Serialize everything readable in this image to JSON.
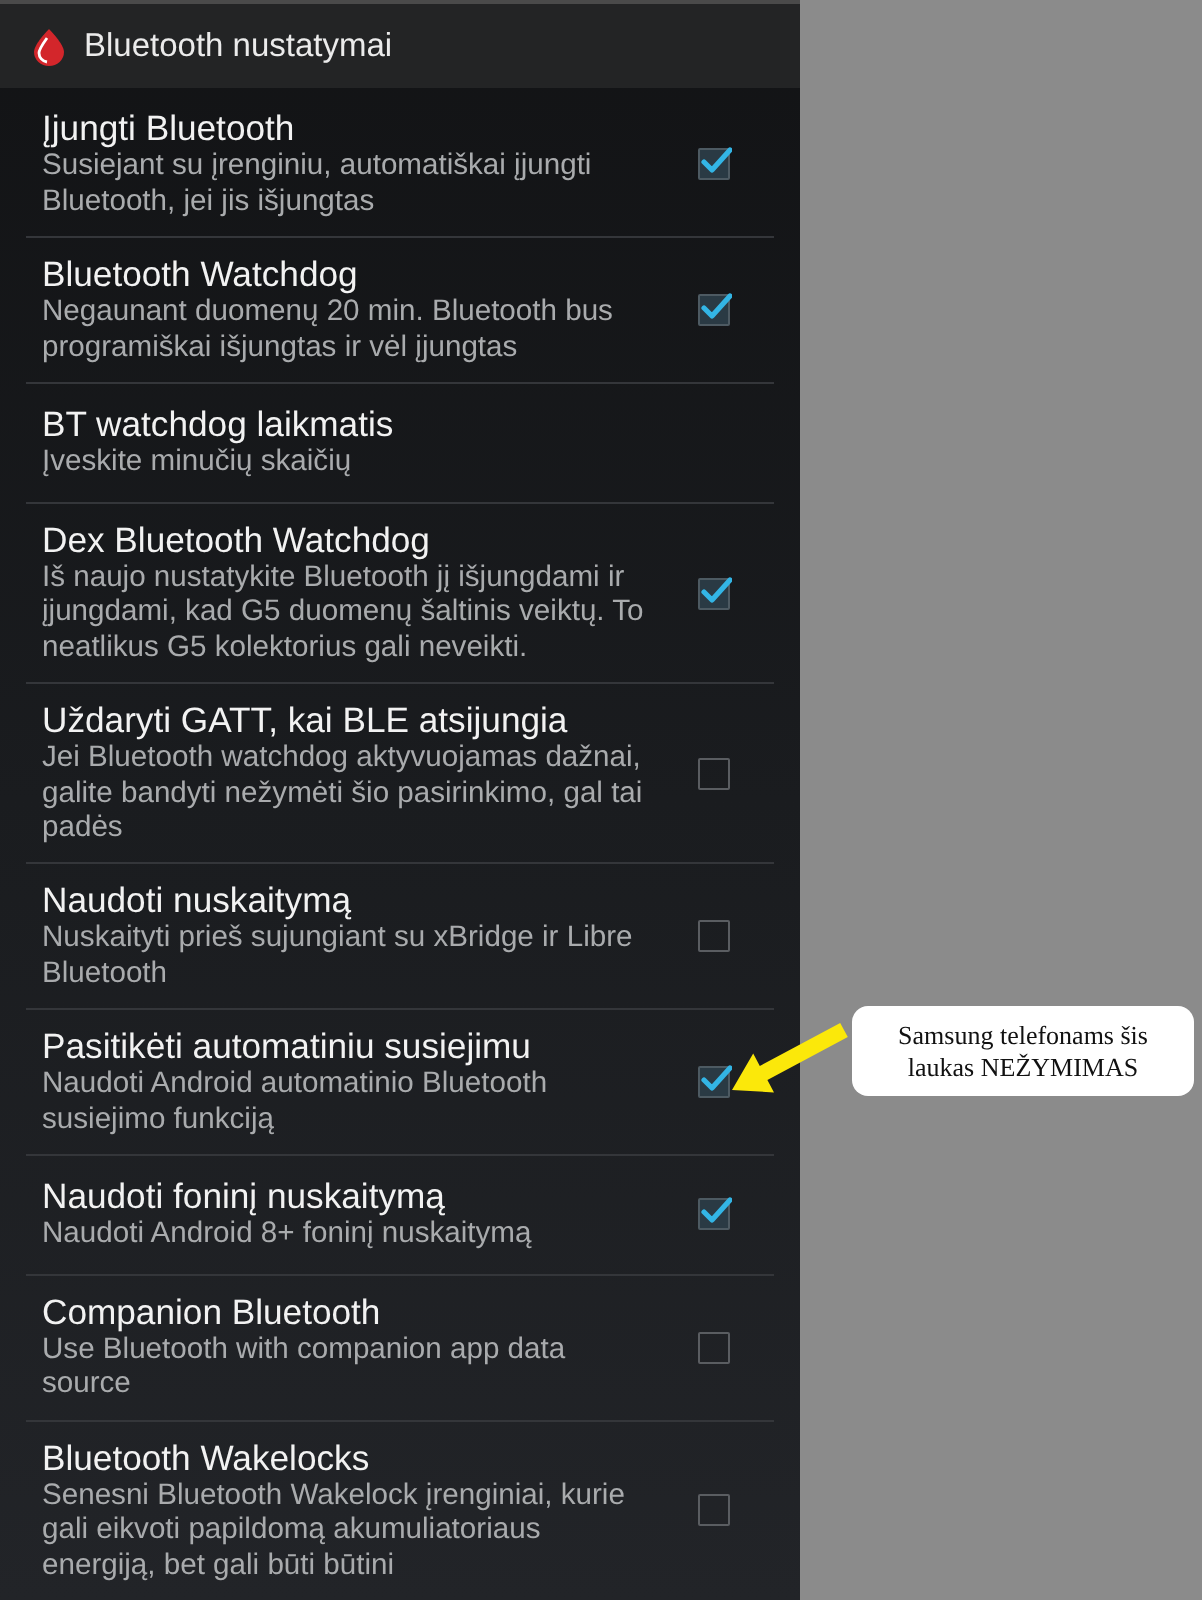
{
  "header": {
    "title": "Bluetooth nustatymai"
  },
  "settings": [
    {
      "kind": "checkbox",
      "title": "Įjungti Bluetooth",
      "summary": "Susiejant su įrenginiu, automatiškai įjungti Bluetooth, jei jis išjungtas",
      "checked": true
    },
    {
      "kind": "checkbox",
      "title": "Bluetooth Watchdog",
      "summary": "Negaunant duomenų 20 min. Bluetooth bus programiškai išjungtas ir vėl įjungtas",
      "checked": true
    },
    {
      "kind": "edit",
      "title": "BT watchdog laikmatis",
      "summary": "Įveskite minučių skaičių"
    },
    {
      "kind": "checkbox",
      "title": "Dex Bluetooth Watchdog",
      "summary": "Iš naujo nustatykite Bluetooth jį išjungdami ir įjungdami, kad G5 duomenų šaltinis veiktų. To neatlikus G5 kolektorius gali neveikti.",
      "checked": true
    },
    {
      "kind": "checkbox",
      "title": "Uždaryti GATT, kai BLE atsijungia",
      "summary": "Jei Bluetooth watchdog aktyvuojamas dažnai, galite bandyti nežymėti šio pasirinkimo, gal tai padės",
      "checked": false
    },
    {
      "kind": "checkbox",
      "title": "Naudoti nuskaitymą",
      "summary": "Nuskaityti prieš sujungiant su xBridge ir Libre Bluetooth",
      "checked": false
    },
    {
      "kind": "checkbox",
      "title": "Pasitikėti automatiniu susiejimu",
      "summary": "Naudoti Android automatinio Bluetooth susiejimo funkciją",
      "checked": true
    },
    {
      "kind": "checkbox",
      "title": "Naudoti foninį nuskaitymą",
      "summary": "Naudoti Android 8+ foninį nuskaitymą",
      "checked": true
    },
    {
      "kind": "checkbox",
      "title": "Companion Bluetooth",
      "summary": "Use Bluetooth with companion app data source",
      "checked": false
    },
    {
      "kind": "checkbox",
      "title": "Bluetooth Wakelocks",
      "summary": "Senesni Bluetooth Wakelock įrenginiai, kurie gali eikvoti papildomą akumuliatoriaus energiją, bet gali būti būtini",
      "checked": false
    }
  ],
  "annotation": {
    "text": "Samsung telefonams šis laukas NEŽYMIMAS"
  }
}
